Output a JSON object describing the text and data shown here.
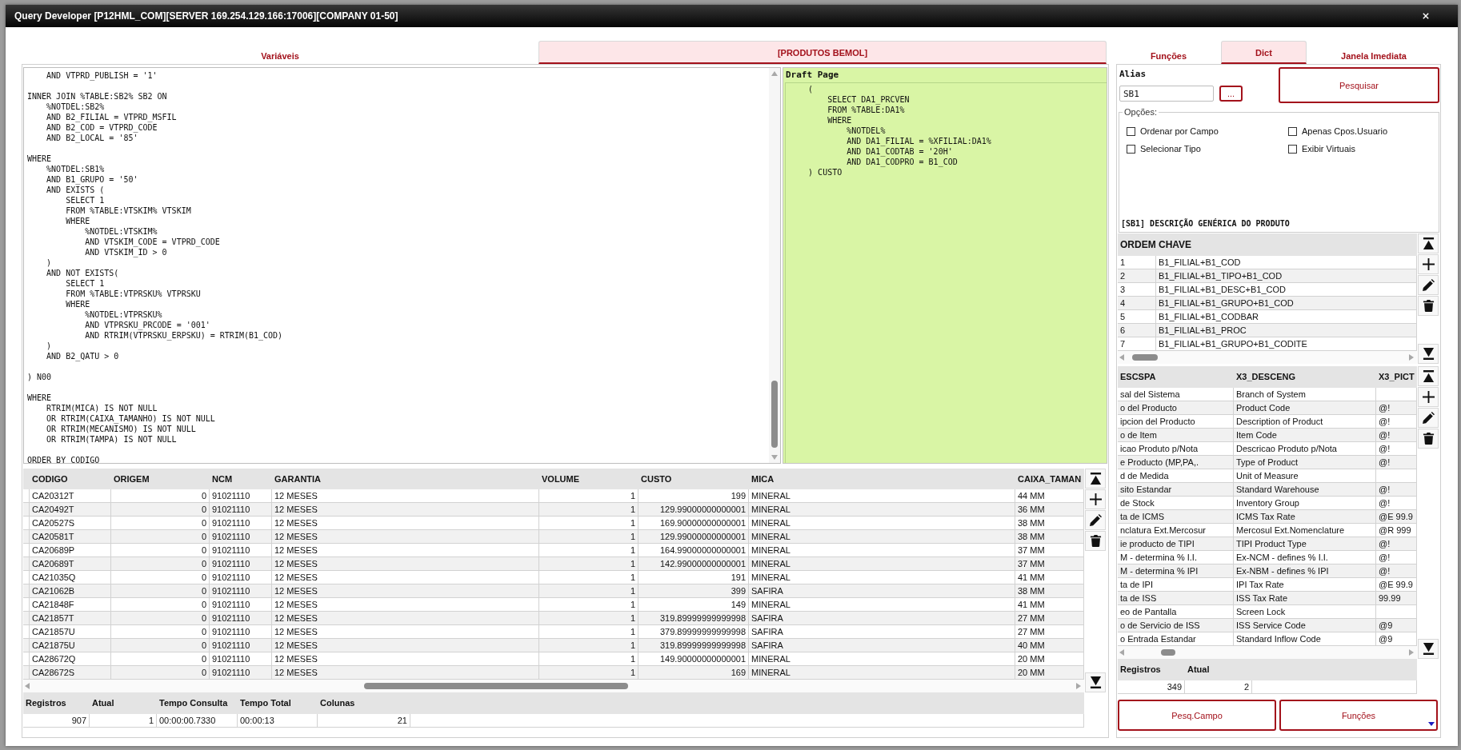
{
  "window": {
    "title": "Query Developer [P12HML_COM][SERVER 169.254.129.166:17006][COMPANY 01-50]"
  },
  "left_tabs": [
    {
      "label": "Variáveis",
      "selected": false
    },
    {
      "label": "[PRODUTOS BEMOL]",
      "selected": true
    }
  ],
  "editor": {
    "code": "    AND VTPRD_PUBLISH = '1'\n\nINNER JOIN %TABLE:SB2% SB2 ON\n    %NOTDEL:SB2%\n    AND B2_FILIAL = VTPRD_MSFIL\n    AND B2_COD = VTPRD_CODE\n    AND B2_LOCAL = '85'\n\nWHERE\n    %NOTDEL:SB1%\n    AND B1_GRUPO = '50'\n    AND EXISTS (\n        SELECT 1\n        FROM %TABLE:VTSKIM% VTSKIM\n        WHERE\n            %NOTDEL:VTSKIM%\n            AND VTSKIM_CODE = VTPRD_CODE\n            AND VTSKIM_ID > 0\n    )\n    AND NOT EXISTS(\n        SELECT 1\n        FROM %TABLE:VTPRSKU% VTPRSKU\n        WHERE\n            %NOTDEL:VTPRSKU%\n            AND VTPRSKU_PRCODE = '001'\n            AND RTRIM(VTPRSKU_ERPSKU) = RTRIM(B1_COD)\n    )\n    AND B2_QATU > 0\n\n) N00\n\nWHERE\n    RTRIM(MICA) IS NOT NULL\n    OR RTRIM(CAIXA_TAMANHO) IS NOT NULL\n    OR RTRIM(MECANISMO) IS NOT NULL\n    OR RTRIM(TAMPA) IS NOT NULL\n\nORDER BY CODIGO"
  },
  "draft_page": {
    "title": "Draft Page",
    "code": "    (\n        SELECT DA1_PRCVEN\n        FROM %TABLE:DA1%\n        WHERE\n            %NOTDEL%\n            AND DA1_FILIAL = %XFILIAL:DA1%\n            AND DA1_CODTAB = '20H'\n            AND DA1_CODPRO = B1_COD\n    ) CUSTO"
  },
  "results": {
    "columns": [
      {
        "label": "CODIGO",
        "kind": "text"
      },
      {
        "label": "ORIGEM",
        "kind": "number"
      },
      {
        "label": "NCM",
        "kind": "text"
      },
      {
        "label": "GARANTIA",
        "kind": "text"
      },
      {
        "label": "VOLUME",
        "kind": "number"
      },
      {
        "label": "CUSTO",
        "kind": "number"
      },
      {
        "label": "MICA",
        "kind": "text"
      },
      {
        "label": "CAIXA_TAMAN",
        "kind": "text"
      }
    ],
    "rows": [
      [
        "CA20312T",
        "0",
        "91021110",
        "12 MESES",
        "1",
        "199",
        "MINERAL",
        "44 MM"
      ],
      [
        "CA20492T",
        "0",
        "91021110",
        "12 MESES",
        "1",
        "129.99000000000001",
        "MINERAL",
        "36 MM"
      ],
      [
        "CA20527S",
        "0",
        "91021110",
        "12 MESES",
        "1",
        "169.90000000000001",
        "MINERAL",
        "38 MM"
      ],
      [
        "CA20581T",
        "0",
        "91021110",
        "12 MESES",
        "1",
        "129.99000000000001",
        "MINERAL",
        "38 MM"
      ],
      [
        "CA20689P",
        "0",
        "91021110",
        "12 MESES",
        "1",
        "164.99000000000001",
        "MINERAL",
        "37 MM"
      ],
      [
        "CA20689T",
        "0",
        "91021110",
        "12 MESES",
        "1",
        "142.99000000000001",
        "MINERAL",
        "37 MM"
      ],
      [
        "CA21035Q",
        "0",
        "91021110",
        "12 MESES",
        "1",
        "191",
        "MINERAL",
        "41 MM"
      ],
      [
        "CA21062B",
        "0",
        "91021110",
        "12 MESES",
        "1",
        "399",
        "SAFIRA",
        "38 MM"
      ],
      [
        "CA21848F",
        "0",
        "91021110",
        "12 MESES",
        "1",
        "149",
        "MINERAL",
        "41 MM"
      ],
      [
        "CA21857T",
        "0",
        "91021110",
        "12 MESES",
        "1",
        "319.89999999999998",
        "SAFIRA",
        "27 MM"
      ],
      [
        "CA21857U",
        "0",
        "91021110",
        "12 MESES",
        "1",
        "379.89999999999998",
        "SAFIRA",
        "27 MM"
      ],
      [
        "CA21875U",
        "0",
        "91021110",
        "12 MESES",
        "1",
        "319.89999999999998",
        "SAFIRA",
        "40 MM"
      ],
      [
        "CA28672Q",
        "0",
        "91021110",
        "12 MESES",
        "1",
        "149.90000000000001",
        "MINERAL",
        "20 MM"
      ],
      [
        "CA28672S",
        "0",
        "91021110",
        "12 MESES",
        "1",
        "169",
        "MINERAL",
        "20 MM"
      ]
    ],
    "summary": {
      "columns": [
        {
          "label": "Registros",
          "kind": "number"
        },
        {
          "label": "Atual",
          "kind": "number"
        },
        {
          "label": "Tempo Consulta",
          "kind": "text"
        },
        {
          "label": "Tempo Total",
          "kind": "text"
        },
        {
          "label": "Colunas",
          "kind": "number"
        }
      ],
      "values": [
        "907",
        "1",
        "00:00:00.7330",
        "00:00:13",
        "21"
      ]
    }
  },
  "right_tabs": [
    {
      "label": "Funções",
      "selected": false
    },
    {
      "label": "Dict",
      "selected": true
    },
    {
      "label": "Janela Imediata",
      "selected": false
    }
  ],
  "dict": {
    "alias_label": "Alias",
    "alias_value": "SB1",
    "lookup_button": "...",
    "search_button": "Pesquisar",
    "options_legend": "Opções:",
    "options": [
      {
        "label": "Ordenar por Campo",
        "checked": false
      },
      {
        "label": "Apenas Cpos.Usuario",
        "checked": false
      },
      {
        "label": "Selecionar Tipo",
        "checked": false
      },
      {
        "label": "Exibir Virtuais",
        "checked": false
      }
    ],
    "table_title": "[SB1] DESCRIÇÃO GENÉRICA DO PRODUTO",
    "index_table": {
      "columns": [
        {
          "label": "ORDEM"
        },
        {
          "label": "CHAVE"
        }
      ],
      "rows": [
        [
          "1",
          "B1_FILIAL+B1_COD"
        ],
        [
          "2",
          "B1_FILIAL+B1_TIPO+B1_COD"
        ],
        [
          "3",
          "B1_FILIAL+B1_DESC+B1_COD"
        ],
        [
          "4",
          "B1_FILIAL+B1_GRUPO+B1_COD"
        ],
        [
          "5",
          "B1_FILIAL+B1_CODBAR"
        ],
        [
          "6",
          "B1_FILIAL+B1_PROC"
        ],
        [
          "7",
          "B1_FILIAL+B1_GRUPO+B1_CODITE"
        ]
      ]
    },
    "fields_table": {
      "columns": [
        {
          "label": "ESCSPA"
        },
        {
          "label": "X3_DESCENG"
        },
        {
          "label": "X3_PICT"
        }
      ],
      "rows": [
        [
          "sal del Sistema",
          "Branch of System"
        ],
        [
          "o del Producto",
          "Product Code",
          "@!"
        ],
        [
          "ipcion del Producto",
          "Description of Product",
          "@!"
        ],
        [
          "o de Item",
          "Item Code",
          "@!"
        ],
        [
          "icao Produto p/Nota",
          "Descricao Produto p/Nota",
          "@!"
        ],
        [
          "e Producto (MP,PA,.",
          "Type of Product",
          "@!"
        ],
        [
          "d de Medida",
          "Unit of Measure"
        ],
        [
          "sito Estandar",
          "Standard Warehouse",
          "@!"
        ],
        [
          "de Stock",
          "Inventory Group",
          "@!"
        ],
        [
          "ta de ICMS",
          "ICMS Tax Rate",
          "@E 99.9"
        ],
        [
          "nclatura Ext.Mercosur",
          "Mercosul Ext.Nomenclature",
          "@R 999"
        ],
        [
          "ie producto de TIPI",
          "TIPI Product Type",
          "@!"
        ],
        [
          "M - determina % I.I.",
          "Ex-NCM - defines % I.I.",
          "@!"
        ],
        [
          "M - determina % IPI",
          "Ex-NBM - defines % IPI",
          "@!"
        ],
        [
          "ta de IPI",
          "IPI Tax Rate",
          "@E 99.9"
        ],
        [
          "ta de ISS",
          "ISS Tax Rate",
          "99.99"
        ],
        [
          "eo de Pantalla",
          "Screen Lock"
        ],
        [
          "o de Servicio de ISS",
          "ISS Service Code",
          "@9"
        ],
        [
          "o Entrada Estandar",
          "Standard Inflow Code",
          "@9"
        ]
      ]
    },
    "summary": {
      "columns": [
        {
          "label": "Registros",
          "kind": "number"
        },
        {
          "label": "Atual",
          "kind": "number"
        }
      ],
      "values": [
        "349",
        "2"
      ]
    },
    "buttons": [
      {
        "label": "Pesq.Campo",
        "dropdown": false
      },
      {
        "label": "Funções",
        "dropdown": true
      }
    ]
  }
}
